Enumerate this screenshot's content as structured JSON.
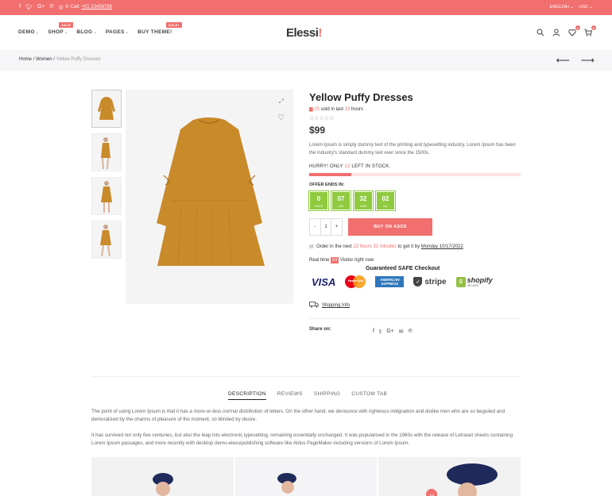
{
  "topbar": {
    "social_icons": [
      "facebook-icon",
      "twitter-icon",
      "google-plus-icon",
      "pinterest-icon",
      "instagram-icon"
    ],
    "call_label": "Call:",
    "phone": "+01 23456789",
    "language": "ENGLISH",
    "currency": "USD",
    "bg_color": "#f16f6f"
  },
  "header": {
    "nav": [
      {
        "label": "DEMO",
        "badge": ""
      },
      {
        "label": "SHOP",
        "badge": "SALE"
      },
      {
        "label": "BLOG",
        "badge": ""
      },
      {
        "label": "PAGES",
        "badge": ""
      },
      {
        "label": "BUY THEME!",
        "badge": "SALE!"
      }
    ],
    "logo_text": "Elessi",
    "logo_mark": "!",
    "wishlist_count": "0",
    "cart_count": "0"
  },
  "breadcrumb": {
    "home": "Home",
    "category": "Women",
    "current": "Yellow Puffy Dresses",
    "sep": "/"
  },
  "product": {
    "title": "Yellow Puffy Dresses",
    "sold_count": "25",
    "sold_mid": "sold in last",
    "sold_hours": "23",
    "sold_tail": "hours",
    "rating": 0,
    "stars": "☆☆☆☆☆",
    "price": "$99",
    "description": "Lorem Ipsum is simply dummy text of the printing and typesetting industry. Lorem Ipsum has been the industry's standard dummy text ever since the 1500s.",
    "hurry_prefix": "HURRY! ONLY",
    "stock_left": "12",
    "hurry_suffix": "LEFT IN STOCK.",
    "stock_fraction": 0.2,
    "offer_label": "OFFER ENDS IN:",
    "countdown": [
      {
        "value": "0",
        "unit": "DAYS"
      },
      {
        "value": "07",
        "unit": "HR"
      },
      {
        "value": "32",
        "unit": "MIN"
      },
      {
        "value": "02",
        "unit": "SC"
      }
    ],
    "qty_minus": "-",
    "qty": "1",
    "qty_plus": "+",
    "buy_label": "BUY ON ASOS",
    "order_prefix": "Order in the next",
    "order_time": "23 hours 32 minutes",
    "order_mid": "to get it by",
    "order_date": "Monday 10/17/2022",
    "realtime_prefix": "Real time",
    "visitor_count": "53",
    "realtime_suffix": "Visitor right now",
    "safe_title": "Guaranteed SAFE Checkout",
    "payments": {
      "visa": "VISA",
      "mastercard": "MasterCard",
      "amex": "AMERICAN EXPRESS",
      "stripe": "stripe",
      "shopify": "shopify",
      "shopify_sub": "SECURE"
    },
    "shipping_label": "Shipping Info",
    "share_label": "Share on:",
    "share_icons": [
      "facebook-icon",
      "twitter-icon",
      "google-plus-icon",
      "email-icon",
      "pinterest-icon"
    ]
  },
  "tabs": [
    {
      "label": "DESCRIPTION",
      "active": true
    },
    {
      "label": "REVIEWS",
      "active": false
    },
    {
      "label": "SHIPPING",
      "active": false
    },
    {
      "label": "CUSTOM TAB",
      "active": false
    }
  ],
  "long_description": [
    "The point of using Lorem Ipsum is that it has a more-or-less normal distribution of letters. On the other hand, we denounce with righteous indignation and dislike men who are so beguiled and demoralized by the charms of pleasure of the moment, so blinded by desire.",
    "It has survived not only five centuries, but also the leap into electronic typesetting, remaining essentially unchanged. It was popularised in the 1960s with the release of Letraset sheets containing Lorem Ipsum passages, and more recently with desktop demo-elessipublishing software like Aldus PageMaker including versions of Lorem Ipsum."
  ],
  "bottom_badge": "114",
  "colors": {
    "accent": "#f16f6f",
    "countdown": "#8fca3f",
    "dress": "#c98a2a"
  }
}
